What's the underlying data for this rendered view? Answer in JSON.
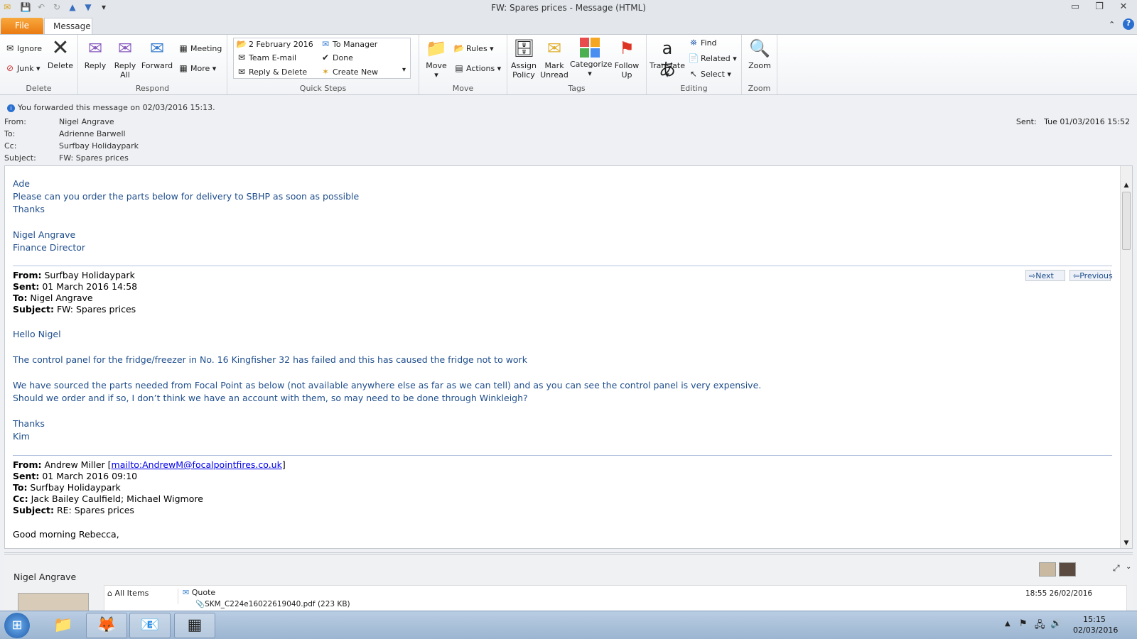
{
  "window": {
    "title": "FW: Spares prices  -  Message (HTML)"
  },
  "tabs": {
    "file": "File",
    "message": "Message"
  },
  "ribbon": {
    "delete": {
      "label": "Delete",
      "ignore": "Ignore",
      "junk": "Junk",
      "delete": "Delete"
    },
    "respond": {
      "label": "Respond",
      "reply": "Reply",
      "reply_all": "Reply All",
      "forward": "Forward",
      "meeting": "Meeting",
      "more": "More"
    },
    "quick_steps": {
      "label": "Quick Steps",
      "items": [
        "2 February 2016",
        "Team E-mail",
        "Reply & Delete",
        "To Manager",
        "Done",
        "Create New"
      ]
    },
    "move": {
      "label": "Move",
      "move": "Move",
      "rules": "Rules",
      "actions": "Actions"
    },
    "tags": {
      "label": "Tags",
      "assign_policy": "Assign Policy",
      "mark_unread": "Mark Unread",
      "categorize": "Categorize",
      "follow_up": "Follow Up"
    },
    "editing": {
      "label": "Editing",
      "translate": "Translate",
      "find": "Find",
      "related": "Related",
      "select": "Select"
    },
    "zoom": {
      "label": "Zoom",
      "zoom": "Zoom"
    }
  },
  "header": {
    "info": "You forwarded this message on 02/03/2016 15:13.",
    "from_label": "From:",
    "from": "Nigel Angrave",
    "to_label": "To:",
    "to": "Adrienne Barwell",
    "cc_label": "Cc:",
    "cc": "Surfbay Holidaypark",
    "subject_label": "Subject:",
    "subject": "FW: Spares prices",
    "sent_label": "Sent:",
    "sent": "Tue 01/03/2016 15:52"
  },
  "body": {
    "intro": [
      "Ade",
      "Please can you order the parts below for delivery to SBHP as soon as possible",
      "Thanks",
      "Nigel Angrave",
      "Finance Director"
    ],
    "fw1": {
      "from_label": "From:",
      "from": " Surfbay Holidaypark",
      "sent_label": "Sent:",
      "sent": " 01 March 2016 14:58",
      "to_label": "To:",
      "to": " Nigel Angrave",
      "subject_label": "Subject:",
      "subject": " FW: Spares prices"
    },
    "nav": {
      "next": "Next",
      "previous": "Previous"
    },
    "msg1": [
      "Hello Nigel",
      "The control panel for the fridge/freezer in No. 16 Kingfisher 32 has failed and this has caused the fridge not to work",
      "We have sourced the parts needed from Focal Point as below (not available anywhere else as far as we can tell) and as you can see the control panel is very expensive.",
      "Should we order and if so, I don’t think we have an account with them, so may need to be done through Winkleigh?",
      "Thanks",
      "Kim"
    ],
    "fw2": {
      "from_label": "From:",
      "from": " Andrew Miller [",
      "mailto": "mailto:AndrewM@focalpointfires.co.uk",
      "from_end": "]",
      "sent_label": "Sent:",
      "sent": " 01 March 2016 09:10",
      "to_label": "To:",
      "to": " Surfbay Holidaypark",
      "cc_label": "Cc:",
      "cc": " Jack Bailey Caulfield; Michael Wigmore",
      "subject_label": "Subject:",
      "subject": " RE: Spares prices"
    },
    "greeting": "Good morning Rebecca,"
  },
  "people_pane": {
    "name": "Nigel Angrave",
    "all_items": "All Items",
    "item_subject": "Quote",
    "attachment": "SKM_C224e16022619040.pdf (223 KB)",
    "item_date": "18:55  26/02/2016"
  },
  "taskbar": {
    "time": "15:15",
    "date": "02/03/2016"
  }
}
